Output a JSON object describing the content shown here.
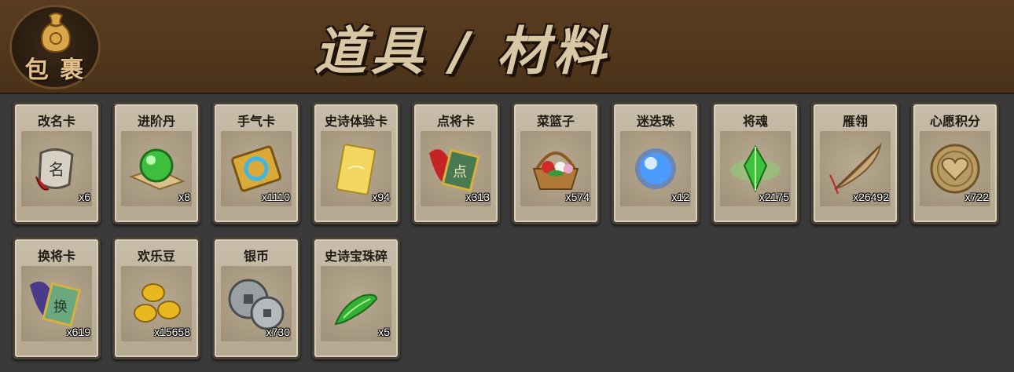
{
  "header": {
    "bag_label": "包 裹",
    "title": "道具 / 材料"
  },
  "items": [
    {
      "name": "改名卡",
      "qty": "x6",
      "icon": "rename-card-icon"
    },
    {
      "name": "进阶丹",
      "qty": "x8",
      "icon": "advance-pill-icon"
    },
    {
      "name": "手气卡",
      "qty": "x1110",
      "icon": "luck-card-icon"
    },
    {
      "name": "史诗体验卡",
      "qty": "x94",
      "icon": "epic-trial-card-icon"
    },
    {
      "name": "点将卡",
      "qty": "x313",
      "icon": "general-pick-card-icon"
    },
    {
      "name": "菜篮子",
      "qty": "x574",
      "icon": "flower-basket-icon"
    },
    {
      "name": "迷迭珠",
      "qty": "x12",
      "icon": "blue-orb-icon"
    },
    {
      "name": "将魂",
      "qty": "x2175",
      "icon": "green-crystal-icon"
    },
    {
      "name": "雁翎",
      "qty": "x26492",
      "icon": "feather-icon"
    },
    {
      "name": "心愿积分",
      "qty": "x722",
      "icon": "heart-coin-icon"
    },
    {
      "name": "换将卡",
      "qty": "x619",
      "icon": "swap-general-card-icon"
    },
    {
      "name": "欢乐豆",
      "qty": "x15658",
      "icon": "gold-beans-icon"
    },
    {
      "name": "银币",
      "qty": "x730",
      "icon": "silver-coins-icon"
    },
    {
      "name": "史诗宝珠碎",
      "qty": "x5",
      "icon": "green-shard-icon"
    }
  ]
}
